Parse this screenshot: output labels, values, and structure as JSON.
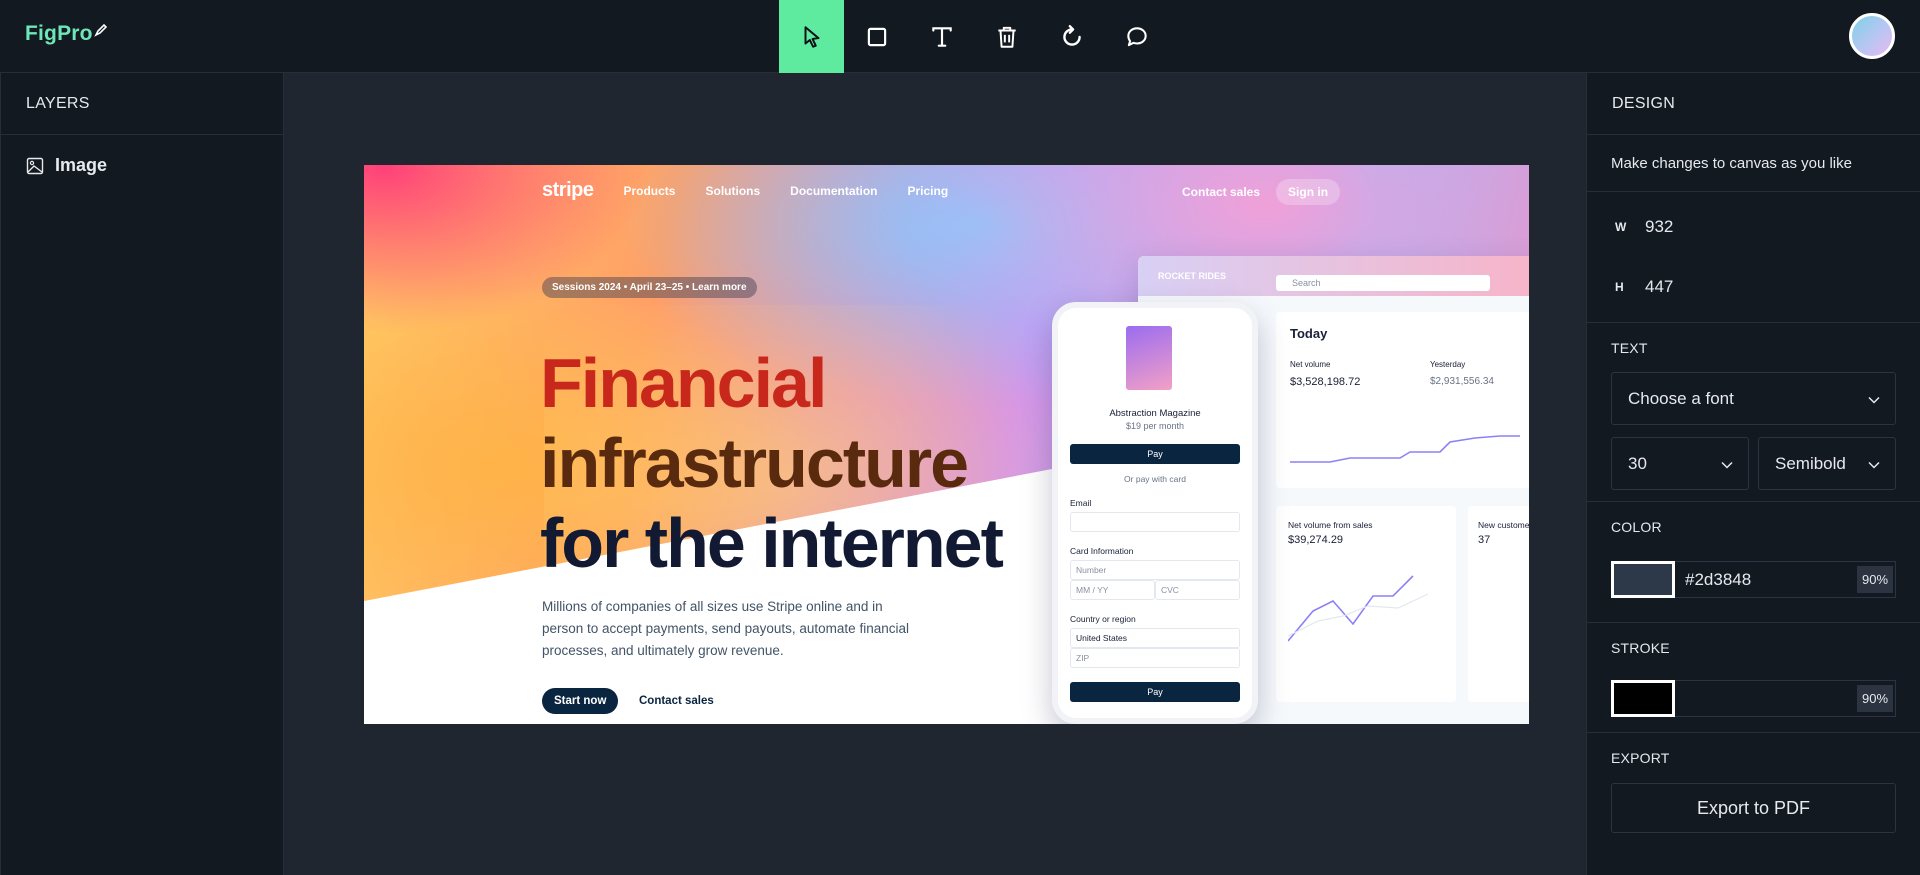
{
  "app": {
    "logo": "FigPro"
  },
  "toolbar": {
    "tools": [
      {
        "name": "select-tool",
        "icon": "cursor-icon",
        "active": true
      },
      {
        "name": "rectangle-tool",
        "icon": "square-icon"
      },
      {
        "name": "text-tool",
        "icon": "text-icon"
      },
      {
        "name": "delete-tool",
        "icon": "trash-icon"
      },
      {
        "name": "reset-tool",
        "icon": "refresh-icon"
      },
      {
        "name": "comment-tool",
        "icon": "chat-bubble-icon"
      }
    ],
    "active_color": "#5eea9f"
  },
  "layers": {
    "title": "LAYERS",
    "items": [
      {
        "label": "Image",
        "icon": "image-icon"
      }
    ]
  },
  "canvas": {
    "image": {
      "nav": {
        "logo": "stripe",
        "links": [
          "Products",
          "Solutions",
          "Documentation",
          "Pricing"
        ],
        "contact": "Contact sales",
        "signin": "Sign in"
      },
      "pill": "Sessions 2024  •  April 23–25  •  Learn more",
      "headline": [
        "Financial",
        "infrastructure",
        "for the internet"
      ],
      "copy": "Millions of companies of all sizes use Stripe online and in person to accept payments, send payouts, automate financial processes, and ultimately grow revenue.",
      "cta_primary": "Start now",
      "cta_secondary": "Contact sales",
      "dashboard": {
        "brand": "ROCKET RIDES",
        "search": "Search",
        "today": "Today",
        "net_volume_label": "Net volume",
        "net_volume_value": "$3,528,198.72",
        "yesterday_label": "Yesterday",
        "yesterday_value": "$2,931,556.34",
        "card1_label": "Net volume from sales",
        "card1_value": "$39,274.29",
        "card2_label": "New customers",
        "card2_value": "37"
      },
      "phone": {
        "product": "Abstraction Magazine",
        "price": "$19 per month",
        "apple_pay": "Pay",
        "or": "Or pay with card",
        "email_label": "Email",
        "card_label": "Card Information",
        "number_ph": "Number",
        "expiry_ph": "MM / YY",
        "cvc_ph": "CVC",
        "country_label": "Country or region",
        "country_value": "United States",
        "zip_ph": "ZIP",
        "pay": "Pay"
      }
    }
  },
  "design": {
    "title": "DESIGN",
    "description": "Make changes to canvas as you like",
    "width_label": "W",
    "width_value": "932",
    "height_label": "H",
    "height_value": "447",
    "text_label": "TEXT",
    "font_placeholder": "Choose a font",
    "font_size": "30",
    "font_weight": "Semibold",
    "color_label": "COLOR",
    "color_value": "#2d3848",
    "color_opacity": "90%",
    "stroke_label": "STROKE",
    "stroke_color": "#000000",
    "stroke_opacity": "90%",
    "export_label": "EXPORT",
    "export_button": "Export to PDF"
  }
}
